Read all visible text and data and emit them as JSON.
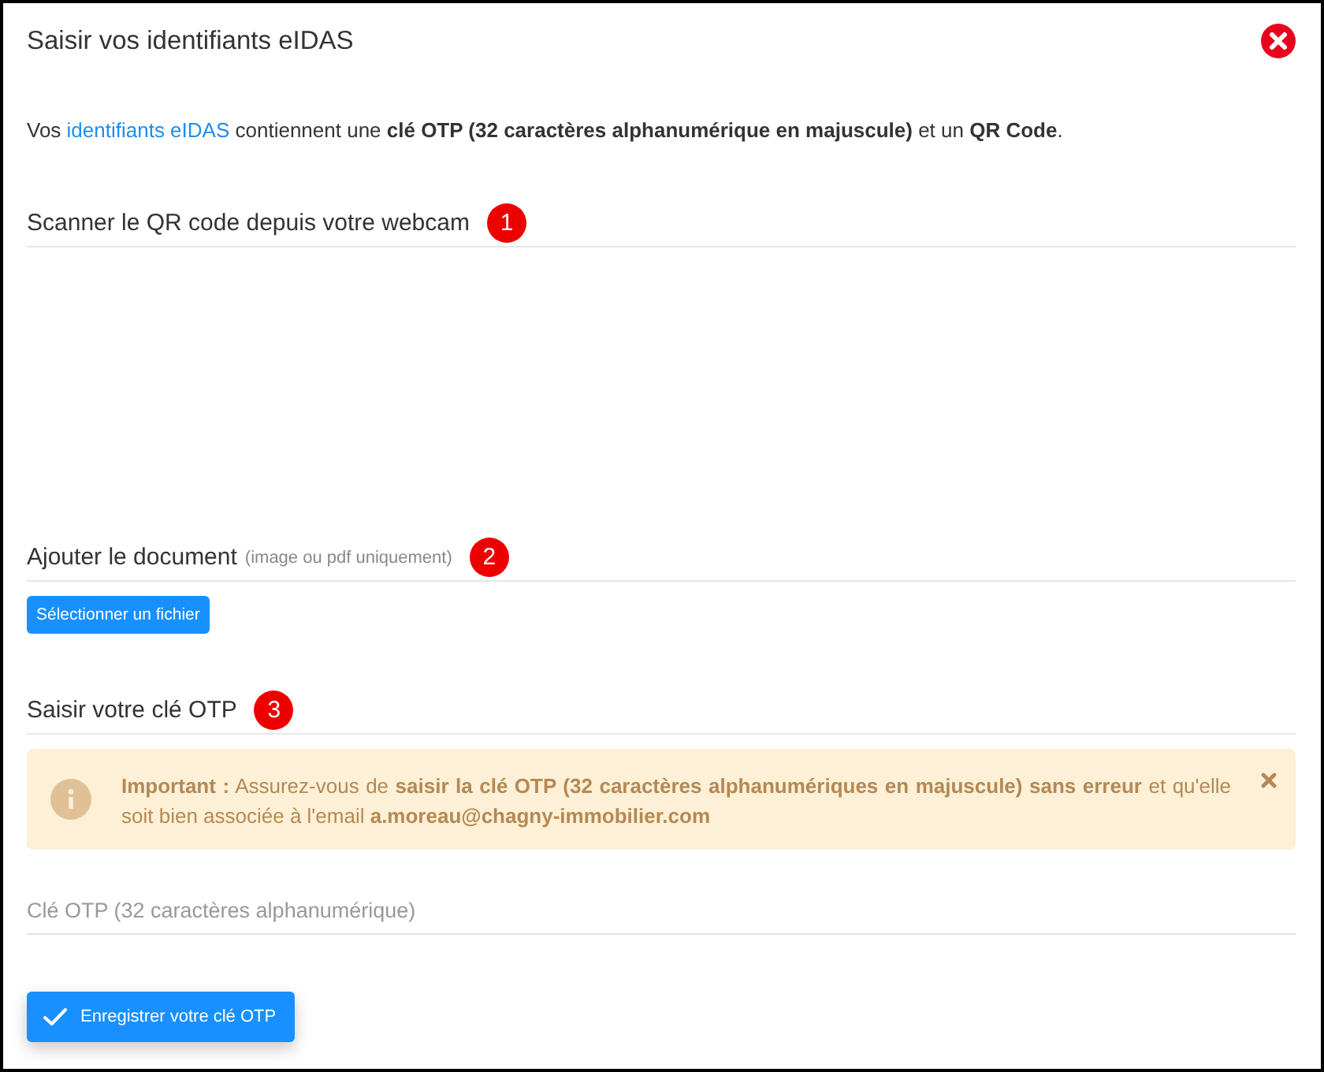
{
  "dialog": {
    "title": "Saisir vos identifiants eIDAS"
  },
  "intro": {
    "before": "Vos ",
    "link": "identifiants eIDAS",
    "after": " contiennent une **clé OTP (32 caractères alphanumérique en majuscule)** et un **QR Code**."
  },
  "sections": [
    {
      "kind": "webcam",
      "heading": "Scanner le QR code depuis votre webcam",
      "step": "1"
    },
    {
      "kind": "upload",
      "heading": "Ajouter le document",
      "note": "(image ou pdf uniquement)",
      "step": "2",
      "button": "Sélectionner un fichier"
    },
    {
      "kind": "otp",
      "heading": "Saisir votre clé OTP",
      "step": "3",
      "alert": {
        "text": "**Important :** Assurez-vous de **saisir la clé OTP (32 caractères alphanumériques en majuscule) sans erreur** et qu'elle soit bien associée à l'email **a.moreau@chagny-immobilier.com**"
      },
      "field": {
        "placeholder": "Clé OTP (32 caractères alphanumérique)"
      },
      "button": "Enregistrer votre clé OTP"
    }
  ]
}
